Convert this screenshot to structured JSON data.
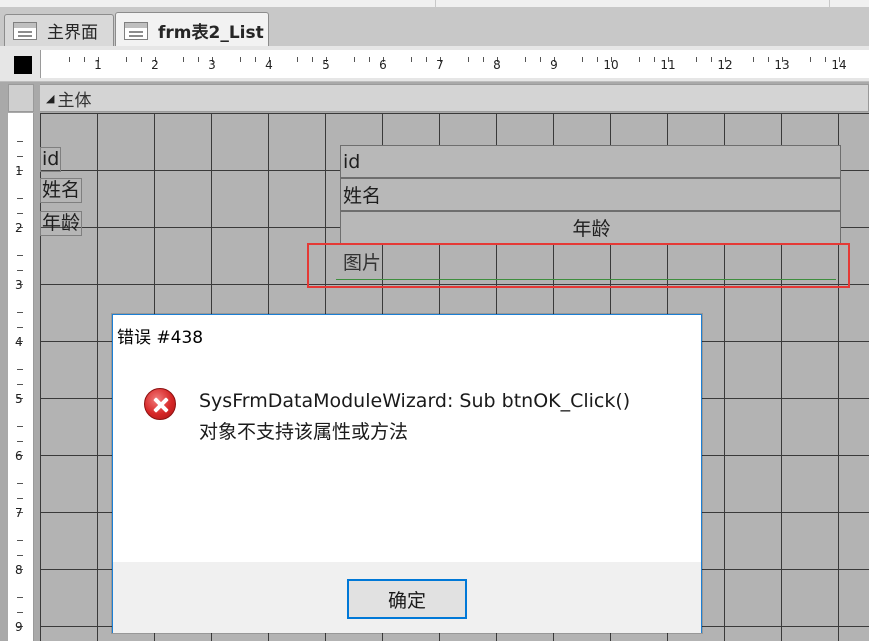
{
  "tabs": [
    {
      "label": "主界面",
      "active": false
    },
    {
      "label": "frm表2_List",
      "active": true
    }
  ],
  "ruler": {
    "numbers": [
      "1",
      "2",
      "3",
      "4",
      "5",
      "6",
      "7",
      "8",
      "9",
      "10",
      "11",
      "12",
      "13",
      "14"
    ],
    "v_numbers": [
      "1",
      "2",
      "3",
      "4",
      "5",
      "6",
      "7",
      "8",
      "9"
    ]
  },
  "section": {
    "label": "主体"
  },
  "labels": {
    "id": "id",
    "name": "姓名",
    "age": "年龄"
  },
  "fields": {
    "id": "id",
    "name": "姓名",
    "age": "年龄",
    "picture": "图片"
  },
  "dialog": {
    "title": "错误 #438",
    "message_line1": "SysFrmDataModuleWizard: Sub btnOK_Click()",
    "message_line2": "对象不支持该属性或方法",
    "ok_label": "确定"
  },
  "colors": {
    "highlight": "#e53935",
    "dialog_border": "#1c7fd4",
    "ok_border": "#0078d7"
  }
}
